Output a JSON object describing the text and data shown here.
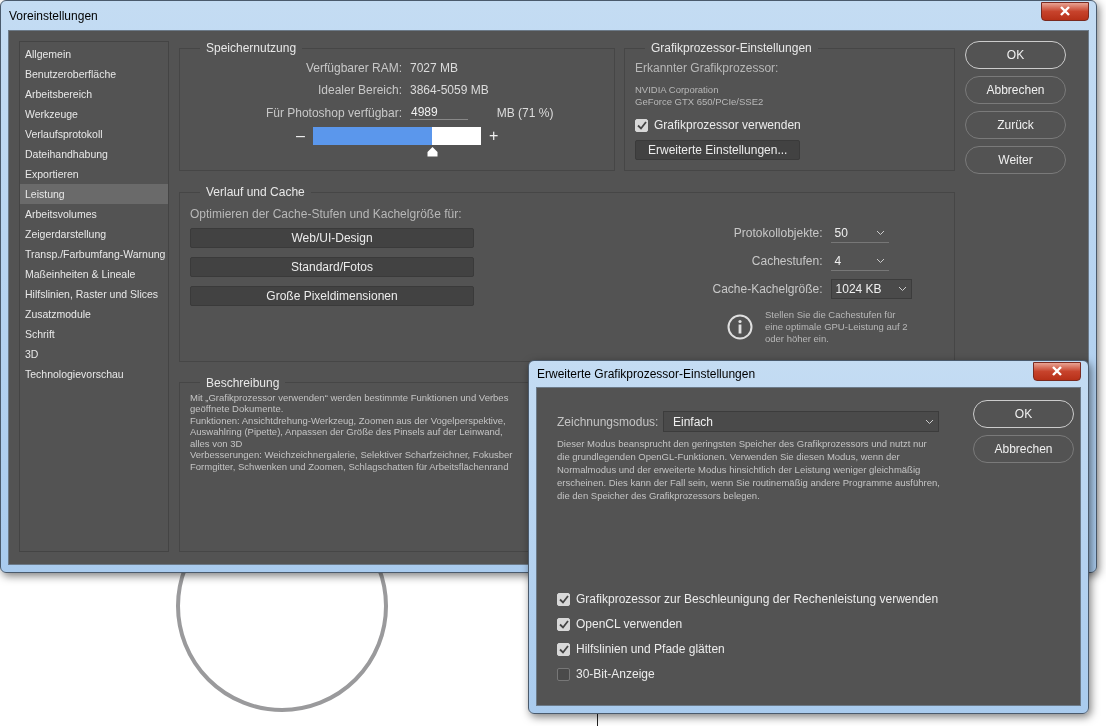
{
  "window": {
    "title": "Voreinstellungen"
  },
  "sidebar": {
    "items": [
      {
        "label": "Allgemein",
        "selected": false
      },
      {
        "label": "Benutzeroberfläche",
        "selected": false
      },
      {
        "label": "Arbeitsbereich",
        "selected": false
      },
      {
        "label": "Werkzeuge",
        "selected": false
      },
      {
        "label": "Verlaufsprotokoll",
        "selected": false
      },
      {
        "label": "Dateihandhabung",
        "selected": false
      },
      {
        "label": "Exportieren",
        "selected": false
      },
      {
        "label": "Leistung",
        "selected": true
      },
      {
        "label": "Arbeitsvolumes",
        "selected": false
      },
      {
        "label": "Zeigerdarstellung",
        "selected": false
      },
      {
        "label": "Transp./Farbumfang-Warnung",
        "selected": false
      },
      {
        "label": "Maßeinheiten & Lineale",
        "selected": false
      },
      {
        "label": "Hilfslinien, Raster und Slices",
        "selected": false
      },
      {
        "label": "Zusatzmodule",
        "selected": false
      },
      {
        "label": "Schrift",
        "selected": false
      },
      {
        "label": "3D",
        "selected": false
      },
      {
        "label": "Technologievorschau",
        "selected": false
      }
    ]
  },
  "memory": {
    "title": "Speichernutzung",
    "rows": [
      {
        "label": "Verfügbarer RAM:",
        "value": "7027 MB"
      },
      {
        "label": "Idealer Bereich:",
        "value": "3864-5059 MB"
      }
    ],
    "photoshop": {
      "label": "Für Photoshop verfügbar:",
      "value": "4989",
      "unit": "MB (71 %)"
    },
    "slider": {
      "minus": "–",
      "plus": "+",
      "level": 0.71
    }
  },
  "gpu": {
    "title": "Grafikprozessor-Einstellungen",
    "detected_label": "Erkannter Grafikprozessor:",
    "detected_lines": [
      "NVIDIA Corporation",
      "GeForce GTX 650/PCIe/SSE2"
    ],
    "use_gpu": {
      "label": "Grafikprozessor verwenden",
      "checked": true
    },
    "advanced_button": "Erweiterte Einstellungen..."
  },
  "buttons": [
    "OK",
    "Abbrechen",
    "Zurück",
    "Weiter"
  ],
  "history_cache": {
    "title": "Verlauf und Cache",
    "prompt": "Optimieren der Cache-Stufen und Kachelgröße für:",
    "presets": [
      "Web/UI-Design",
      "Standard/Fotos",
      "Große Pixeldimensionen"
    ],
    "fields": [
      {
        "label": "Protokollobjekte:",
        "value": "50",
        "kind": "underline"
      },
      {
        "label": "Cachestufen:",
        "value": "4",
        "kind": "underline"
      },
      {
        "label": "Cache-Kachelgröße:",
        "value": "1024 KB",
        "kind": "boxed"
      }
    ],
    "info": "Stellen Sie die Cachestufen für eine optimale GPU-Leistung auf 2 oder höher ein."
  },
  "description": {
    "title": "Beschreibung",
    "lines": [
      "Mit „Grafikprozessor verwenden“ werden bestimmte Funktionen und Verbes",
      "geöffnete Dokumente.",
      "Funktionen: Ansichtdrehung-Werkzeug, Zoomen aus der Vogelperspektive,",
      "Auswahlring (Pipette), Anpassen der Größe des Pinsels auf der Leinwand,",
      "alles von 3D",
      "Verbesserungen: Weichzeichnergalerie, Selektiver Scharfzeichner, Fokusber",
      "Formgitter, Schwenken und Zoomen, Schlagschatten für Arbeitsflächenrand"
    ]
  },
  "dialog": {
    "title": "Erweiterte Grafikprozessor-Einstellungen",
    "mode": {
      "label": "Zeichnungsmodus:",
      "value": "Einfach"
    },
    "text": "Dieser Modus beansprucht den geringsten Speicher des Grafikprozessors und nutzt nur die grundlegenden OpenGL-Funktionen. Verwenden Sie diesen Modus, wenn der Normalmodus und der erweiterte Modus hinsichtlich der Leistung weniger gleichmäßig erscheinen. Dies kann der Fall sein, wenn Sie routinemäßig andere Programme ausführen, die den Speicher des Grafikprozessors belegen.",
    "buttons": [
      "OK",
      "Abbrechen"
    ],
    "options": [
      {
        "label": "Grafikprozessor zur Beschleunigung der Rechenleistung verwenden",
        "checked": true
      },
      {
        "label": "OpenCL verwenden",
        "checked": true
      },
      {
        "label": "Hilfslinien und Pfade glätten",
        "checked": true
      },
      {
        "label": "30-Bit-Anzeige",
        "checked": false
      }
    ]
  }
}
